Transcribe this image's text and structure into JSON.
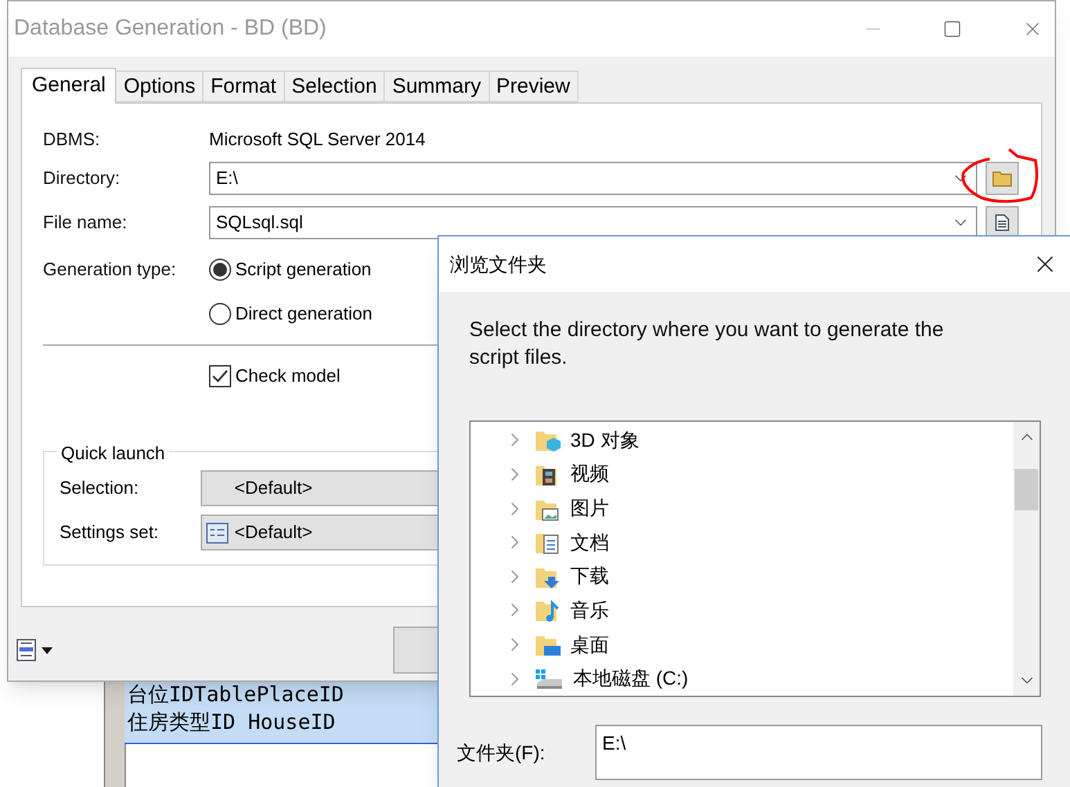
{
  "main_dialog": {
    "title": "Database Generation - BD (BD)",
    "tabs": [
      {
        "label": "General",
        "selected": true
      },
      {
        "label": "Options",
        "selected": false
      },
      {
        "label": "Format",
        "selected": false
      },
      {
        "label": "Selection",
        "selected": false
      },
      {
        "label": "Summary",
        "selected": false
      },
      {
        "label": "Preview",
        "selected": false
      }
    ],
    "dbms": {
      "label": "DBMS:",
      "value": "Microsoft SQL Server 2014"
    },
    "directory": {
      "label": "Directory:",
      "value": "E:\\"
    },
    "file_name": {
      "label": "File name:",
      "value": "SQLsql.sql"
    },
    "generation_type": {
      "label": "Generation type:",
      "options": [
        {
          "label": "Script generation",
          "selected": true
        },
        {
          "label": "Direct generation",
          "selected": false
        }
      ]
    },
    "check_model": {
      "label": "Check model",
      "checked": true
    },
    "quick_launch": {
      "title": "Quick launch",
      "selection": {
        "label": "Selection:",
        "value": "<Default>"
      },
      "settings_set": {
        "label": "Settings set:",
        "value": "<Default>"
      }
    }
  },
  "background_text": {
    "lines": [
      "台位IDTablePlaceID",
      "住房类型ID HouseID"
    ]
  },
  "browse_dialog": {
    "title": "浏览文件夹",
    "message": "Select the directory where you want to generate the script files.",
    "tree": [
      {
        "label": "3D 对象",
        "kind": "objects3d"
      },
      {
        "label": "视频",
        "kind": "video"
      },
      {
        "label": "图片",
        "kind": "pictures"
      },
      {
        "label": "文档",
        "kind": "documents"
      },
      {
        "label": "下载",
        "kind": "downloads"
      },
      {
        "label": "音乐",
        "kind": "music"
      },
      {
        "label": "桌面",
        "kind": "desktop"
      },
      {
        "label": "本地磁盘 (C:)",
        "kind": "drive"
      }
    ],
    "folder": {
      "label": "文件夹(F):",
      "value": "E:\\"
    }
  }
}
